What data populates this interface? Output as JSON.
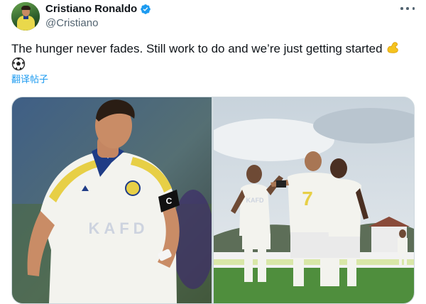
{
  "author": {
    "display_name": "Cristiano Ronaldo",
    "handle": "@Cristiano",
    "verified": true,
    "avatar": "profile-photo"
  },
  "tweet": {
    "text": "The hunger never fades. Still work to do and we’re just getting started",
    "emojis": [
      "flexed-biceps-emoji",
      "soccer-ball-emoji"
    ],
    "translate_label": "翻译帖子"
  },
  "media": {
    "photos": [
      {
        "description_icon": "photo-player-closeup",
        "jersey_text": "KAFD"
      },
      {
        "description_icon": "photo-team-celebration",
        "jersey_number": "7",
        "jersey_text": "KAFD"
      }
    ]
  },
  "colors": {
    "text": "#0f1419",
    "secondary": "#536471",
    "link": "#1d9bf0",
    "verified": "#1d9bf0",
    "jersey": "#f3f3ee",
    "jersey_trim": "#1f3c86",
    "jersey_yellow": "#e7cf46"
  }
}
